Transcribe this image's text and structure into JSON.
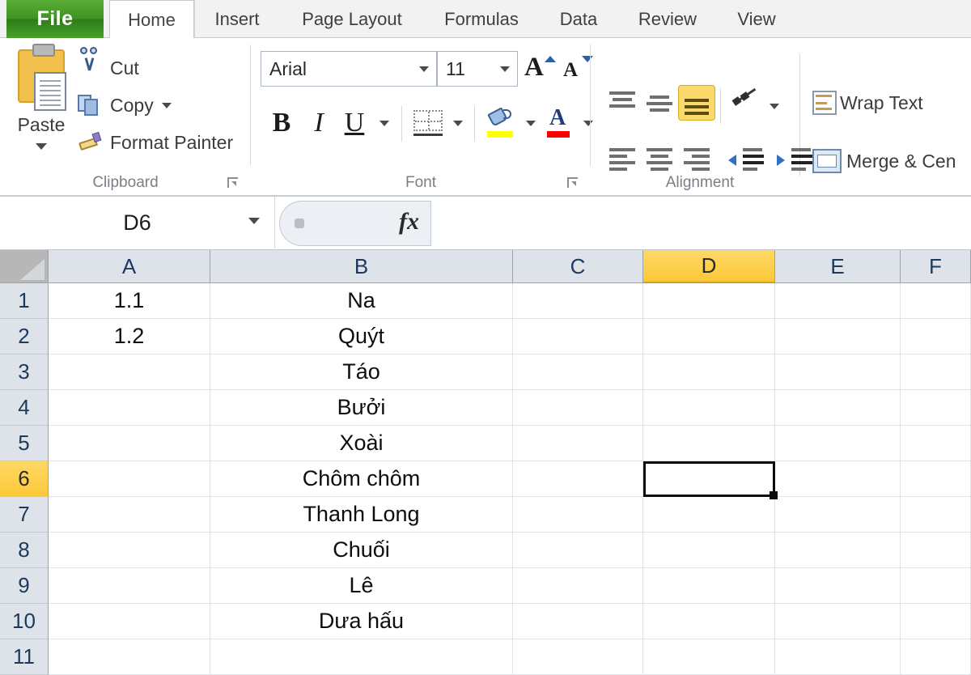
{
  "ribbon": {
    "tabs": [
      {
        "label": "File",
        "active": false,
        "file": true
      },
      {
        "label": "Home",
        "active": true
      },
      {
        "label": "Insert",
        "active": false
      },
      {
        "label": "Page Layout",
        "active": false
      },
      {
        "label": "Formulas",
        "active": false
      },
      {
        "label": "Data",
        "active": false
      },
      {
        "label": "Review",
        "active": false
      },
      {
        "label": "View",
        "active": false
      }
    ],
    "groups": {
      "clipboard": {
        "label": "Clipboard",
        "paste": "Paste",
        "cut": "Cut",
        "copy": "Copy",
        "format_painter": "Format Painter"
      },
      "font": {
        "label": "Font",
        "font_name": "Arial",
        "font_size": "11",
        "bold": "B",
        "italic": "I",
        "underline": "U",
        "fill_color": "#ffff00",
        "font_color": "#ff0000"
      },
      "alignment": {
        "label": "Alignment",
        "wrap_text": "Wrap Text",
        "merge_center": "Merge & Cen"
      }
    }
  },
  "formula_bar": {
    "name_box": "D6",
    "formula_value": ""
  },
  "sheet": {
    "columns": [
      "A",
      "B",
      "C",
      "D",
      "E",
      "F"
    ],
    "selected_column": "D",
    "selected_row": 6,
    "selected_cell": "D6",
    "rows": [
      {
        "num": "1",
        "A": "1.1",
        "B": "Na",
        "C": "",
        "D": "",
        "E": "",
        "F": ""
      },
      {
        "num": "2",
        "A": "1.2",
        "B": "Quýt",
        "C": "",
        "D": "",
        "E": "",
        "F": ""
      },
      {
        "num": "3",
        "A": "",
        "B": "Táo",
        "C": "",
        "D": "",
        "E": "",
        "F": ""
      },
      {
        "num": "4",
        "A": "",
        "B": "Bưởi",
        "C": "",
        "D": "",
        "E": "",
        "F": ""
      },
      {
        "num": "5",
        "A": "",
        "B": "Xoài",
        "C": "",
        "D": "",
        "E": "",
        "F": ""
      },
      {
        "num": "6",
        "A": "",
        "B": "Chôm chôm",
        "C": "",
        "D": "",
        "E": "",
        "F": ""
      },
      {
        "num": "7",
        "A": "",
        "B": "Thanh Long",
        "C": "",
        "D": "",
        "E": "",
        "F": ""
      },
      {
        "num": "8",
        "A": "",
        "B": "Chuối",
        "C": "",
        "D": "",
        "E": "",
        "F": ""
      },
      {
        "num": "9",
        "A": "",
        "B": "Lê",
        "C": "",
        "D": "",
        "E": "",
        "F": ""
      },
      {
        "num": "10",
        "A": "",
        "B": "Dưa hấu",
        "C": "",
        "D": "",
        "E": "",
        "F": ""
      },
      {
        "num": "11",
        "A": "",
        "B": "",
        "C": "",
        "D": "",
        "E": "",
        "F": ""
      }
    ]
  },
  "colors": {
    "file_tab_green": "#3f9422",
    "selection_gold": "#fcc837",
    "header_blue": "#1c3a5e"
  }
}
